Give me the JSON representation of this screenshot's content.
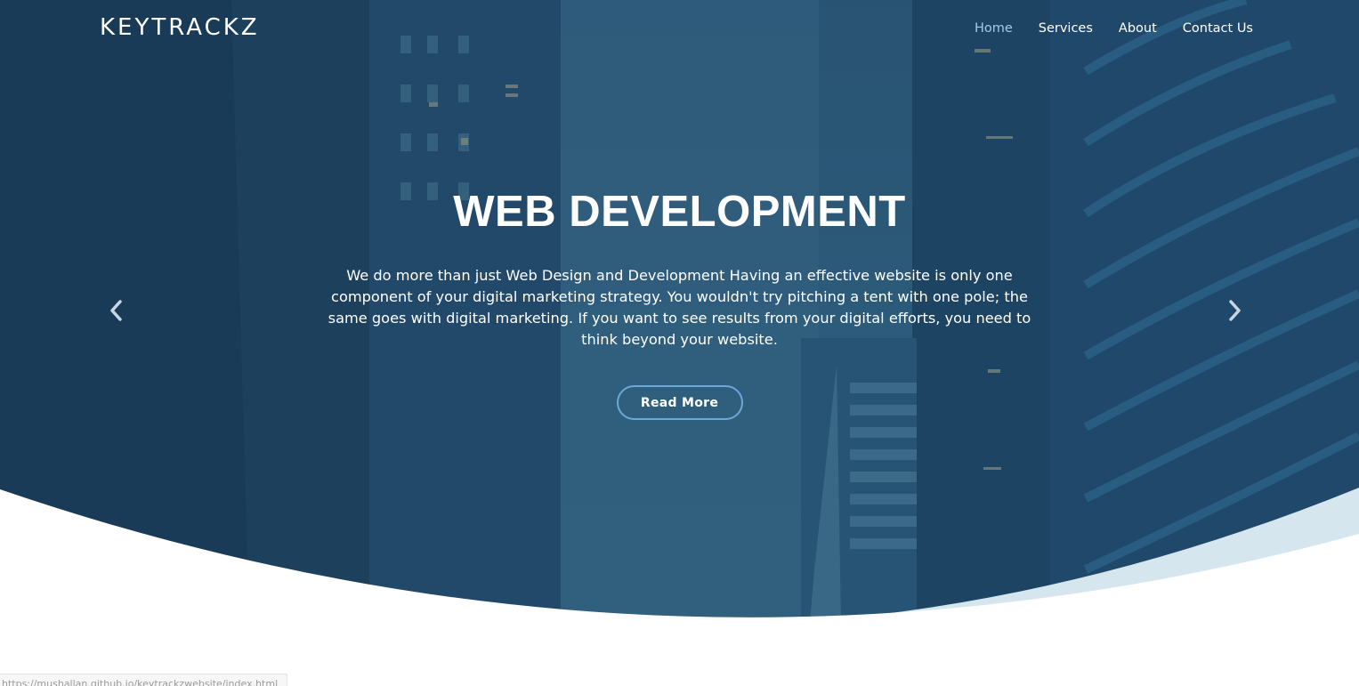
{
  "navbar": {
    "brand": "KEYTRACKZ",
    "links": [
      {
        "label": "Home",
        "active": true
      },
      {
        "label": "Services",
        "active": false
      },
      {
        "label": "About",
        "active": false
      },
      {
        "label": "Contact Us",
        "active": false
      }
    ]
  },
  "hero": {
    "title": "WEB DEVELOPMENT",
    "text": "We do more than just Web Design and Development Having an effective website is only one component of your digital marketing strategy. You wouldn't try pitching a tent with one pole; the same goes with digital marketing. If you want to see results from your digital efforts, you need to think beyond your website.",
    "button_label": "Read More",
    "prev_icon": "chevron-left-icon",
    "next_icon": "chevron-right-icon"
  },
  "status_bar": {
    "url": "https://mushallan.github.io/keytrackzwebsite/index.html"
  },
  "colors": {
    "hero_overlay": "#1f4a6b",
    "wave_light": "#d5e6ef",
    "active_link": "#a9c9e8",
    "button_border": "#6fa8d6"
  }
}
